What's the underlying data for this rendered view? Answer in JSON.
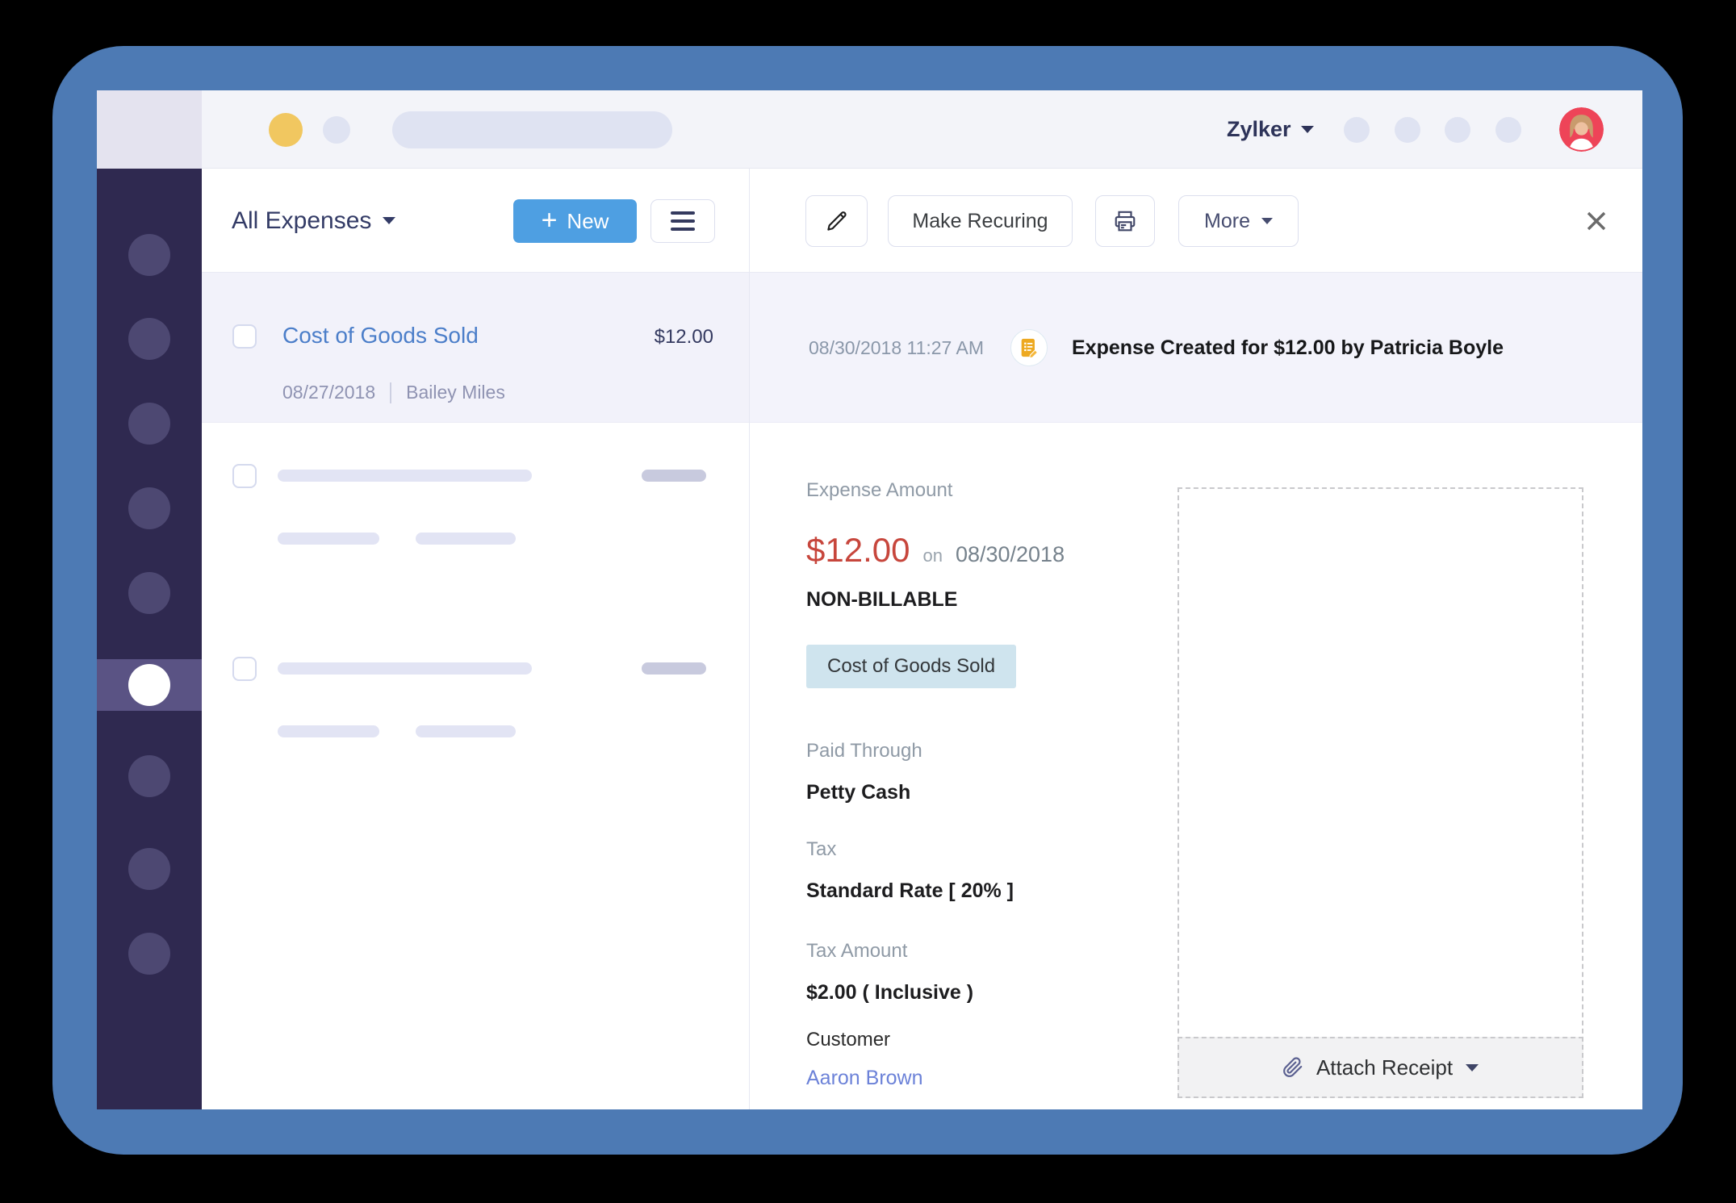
{
  "topbar": {
    "brand": "Zylker"
  },
  "expenses_panel": {
    "title": "All Expenses",
    "new_button": "New",
    "selected_expense": {
      "title": "Cost of Goods Sold",
      "amount": "$12.00",
      "date": "08/27/2018",
      "submitted_by": "Bailey Miles"
    }
  },
  "detail_panel": {
    "toolbar": {
      "make_recurring": "Make Recuring",
      "more": "More"
    },
    "history": {
      "timestamp": "08/30/2018 11:27 AM",
      "event": "Expense Created for $12.00 by Patricia Boyle"
    },
    "expense": {
      "amount_label": "Expense Amount",
      "amount": "$12.00",
      "conjunction": "on",
      "date": "08/30/2018",
      "billable_status": "NON-BILLABLE",
      "category": "Cost of Goods Sold",
      "paid_through_label": "Paid Through",
      "paid_through": "Petty Cash",
      "tax_label": "Tax",
      "tax": "Standard Rate [ 20% ]",
      "tax_amount_label": "Tax Amount",
      "tax_amount": "$2.00 ( Inclusive )",
      "customer_label": "Customer",
      "customer": "Aaron Brown"
    },
    "receipt": {
      "attach_label": "Attach Receipt"
    }
  },
  "colors": {
    "frame_blue": "#4d7ab4",
    "sidebar_purple": "#2f2950",
    "accent_blue": "#4e9fe2",
    "amount_red": "#c7463c",
    "link_blue": "#6c82d8",
    "category_tag_bg": "#cfe4ee",
    "avatar_bg": "#ee4458",
    "traffic_dot_yellow": "#f1c760"
  }
}
